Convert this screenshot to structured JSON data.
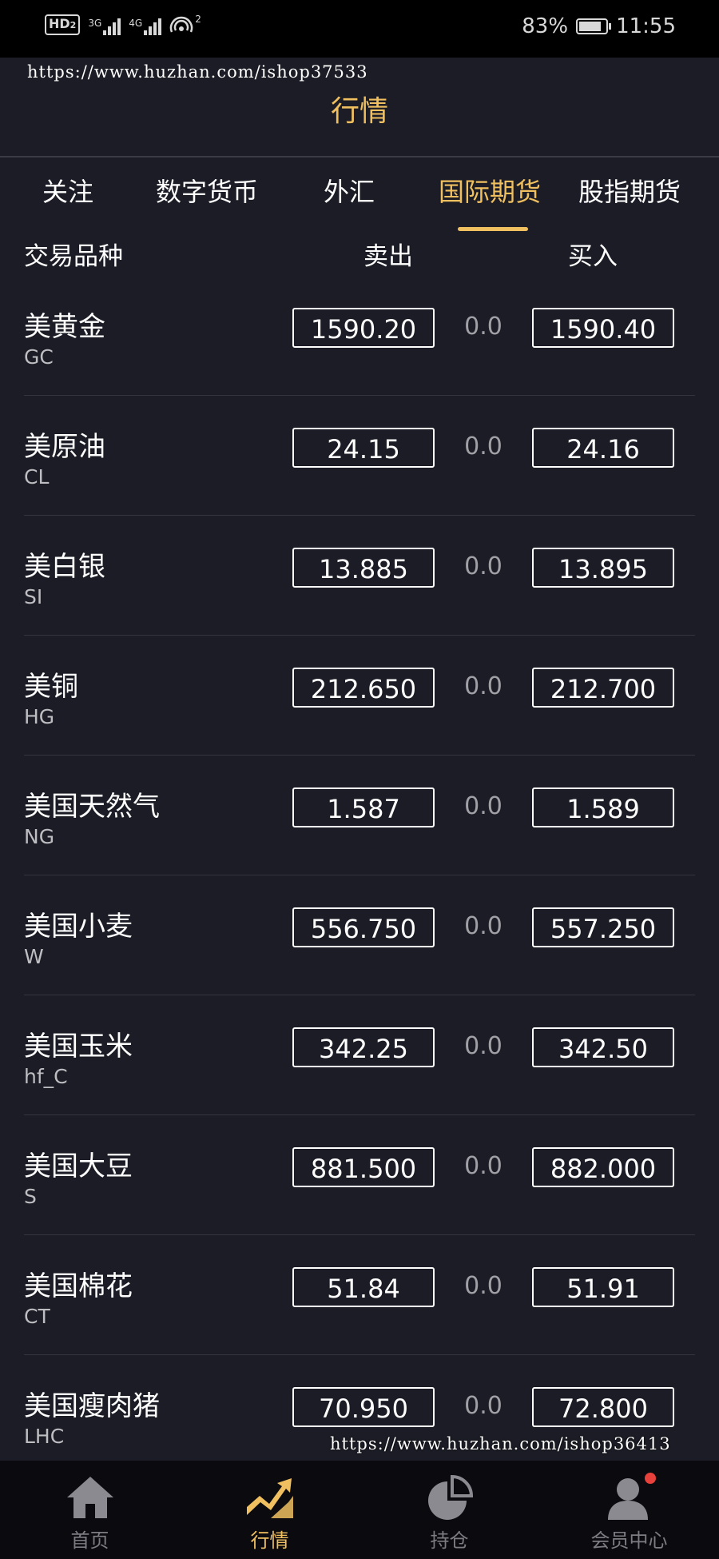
{
  "status_bar": {
    "hd": "HD",
    "hd_sim": "2",
    "net1": "3G",
    "net2": "4G",
    "hotspot_count": "2",
    "battery": "83%",
    "time": "11:55",
    "battery_level": 0.83
  },
  "watermarks": {
    "top": "https://www.huzhan.com/ishop37533",
    "bottom": "https://www.huzhan.com/ishop36413"
  },
  "header": {
    "title": "行情"
  },
  "tabs": [
    {
      "label": "关注"
    },
    {
      "label": "数字货币"
    },
    {
      "label": "外汇"
    },
    {
      "label": "国际期货",
      "active": true
    },
    {
      "label": "股指期货"
    }
  ],
  "columns": {
    "name": "交易品种",
    "sell": "卖出",
    "buy": "买入"
  },
  "rows": [
    {
      "name": "美黄金",
      "code": "GC",
      "sell": "1590.20",
      "change": "0.0",
      "buy": "1590.40"
    },
    {
      "name": "美原油",
      "code": "CL",
      "sell": "24.15",
      "change": "0.0",
      "buy": "24.16"
    },
    {
      "name": "美白银",
      "code": "SI",
      "sell": "13.885",
      "change": "0.0",
      "buy": "13.895"
    },
    {
      "name": "美铜",
      "code": "HG",
      "sell": "212.650",
      "change": "0.0",
      "buy": "212.700"
    },
    {
      "name": "美国天然气",
      "code": "NG",
      "sell": "1.587",
      "change": "0.0",
      "buy": "1.589"
    },
    {
      "name": "美国小麦",
      "code": "W",
      "sell": "556.750",
      "change": "0.0",
      "buy": "557.250"
    },
    {
      "name": "美国玉米",
      "code": "hf_C",
      "sell": "342.25",
      "change": "0.0",
      "buy": "342.50"
    },
    {
      "name": "美国大豆",
      "code": "S",
      "sell": "881.500",
      "change": "0.0",
      "buy": "882.000"
    },
    {
      "name": "美国棉花",
      "code": "CT",
      "sell": "51.84",
      "change": "0.0",
      "buy": "51.91"
    },
    {
      "name": "美国瘦肉猪",
      "code": "LHC",
      "sell": "70.950",
      "change": "0.0",
      "buy": "72.800"
    }
  ],
  "bottom_nav": [
    {
      "label": "首页",
      "icon": "home-icon"
    },
    {
      "label": "行情",
      "icon": "market-chart-icon",
      "active": true
    },
    {
      "label": "持仓",
      "icon": "pie-chart-icon"
    },
    {
      "label": "会员中心",
      "icon": "user-icon",
      "badge": true
    }
  ],
  "colors": {
    "background": "#1b1c25",
    "accent": "#f0c060",
    "nav_background": "#0b0b0f",
    "badge": "#e8413c"
  }
}
